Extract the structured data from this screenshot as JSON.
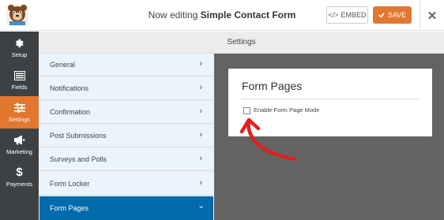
{
  "header": {
    "prefix": "Now editing",
    "form_name": "Simple Contact Form",
    "embed_label": "EMBED",
    "save_label": "SAVE"
  },
  "sidebar": {
    "items": [
      {
        "label": "Setup",
        "icon": "gear-icon"
      },
      {
        "label": "Fields",
        "icon": "fields-list-icon"
      },
      {
        "label": "Settings",
        "icon": "sliders-icon",
        "active": true
      },
      {
        "label": "Marketing",
        "icon": "megaphone-icon"
      },
      {
        "label": "Payments",
        "icon": "dollar-icon"
      }
    ]
  },
  "settings": {
    "heading": "Settings",
    "panels": [
      {
        "label": "General"
      },
      {
        "label": "Notifications"
      },
      {
        "label": "Confirmation"
      },
      {
        "label": "Post Submissions"
      },
      {
        "label": "Surveys and Polls"
      },
      {
        "label": "Form Locker"
      },
      {
        "label": "Form Pages",
        "active": true
      }
    ]
  },
  "form_pages_card": {
    "title": "Form Pages",
    "checkbox_label": "Enable Form Page Mode",
    "checkbox_checked": false
  },
  "colors": {
    "accent_orange": "#e27730",
    "active_blue": "#036aab",
    "sidebar_bg": "#3e4144",
    "preview_bg": "#636363",
    "annotation_red": "#e0201b"
  }
}
